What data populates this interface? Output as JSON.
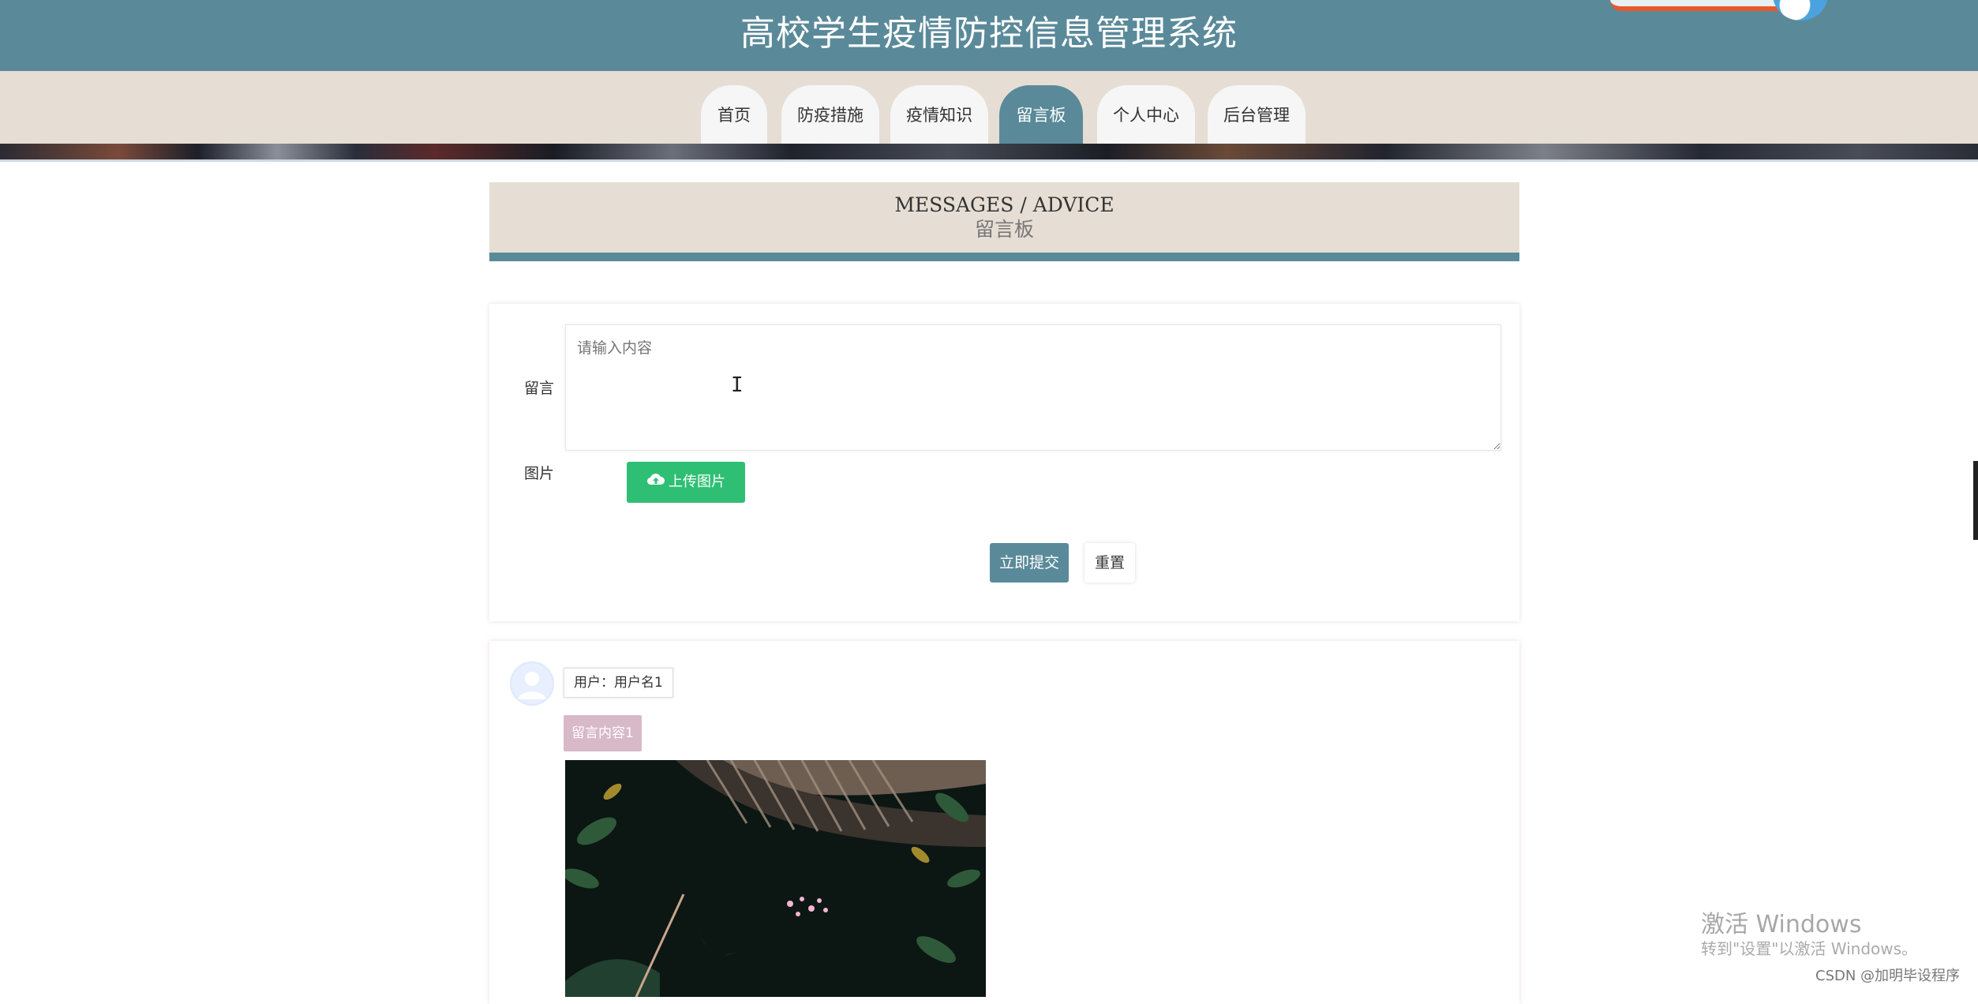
{
  "header": {
    "title": "高校学生疫情防控信息管理系统"
  },
  "nav": {
    "tabs": [
      {
        "label": "首页"
      },
      {
        "label": "防疫措施"
      },
      {
        "label": "疫情知识"
      },
      {
        "label": "留言板",
        "active": true
      },
      {
        "label": "个人中心"
      },
      {
        "label": "后台管理"
      }
    ]
  },
  "section": {
    "title_en": "MESSAGES / ADVICE",
    "title_zh": "留言板"
  },
  "form": {
    "message_label": "留言",
    "message_placeholder": "请输入内容",
    "image_label": "图片",
    "upload_label": "上传图片",
    "submit_label": "立即提交",
    "reset_label": "重置"
  },
  "messages": [
    {
      "user": "用户：用户名1",
      "content": "留言内容1"
    }
  ],
  "watermark": {
    "activate_title": "激活 Windows",
    "activate_sub": "转到\"设置\"以激活 Windows。",
    "csdn": "CSDN @加明毕设程序"
  },
  "colors": {
    "primary": "#5a8a99",
    "nav_bg": "#e6ded4",
    "upload_green": "#2fbf74",
    "content_tag": "#d8b9c8"
  },
  "icons": {
    "upload": "cloud-upload-icon",
    "avatar": "user-avatar-icon"
  }
}
